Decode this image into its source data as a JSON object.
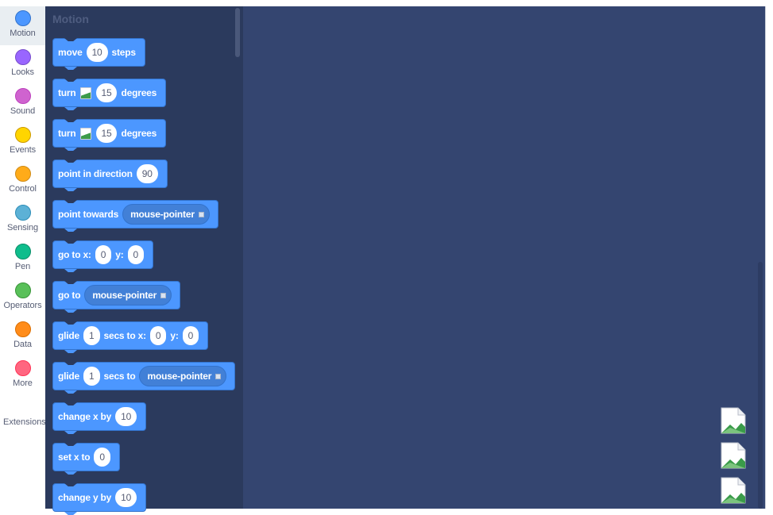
{
  "top_fragment": "1006",
  "categories": [
    {
      "label": "Motion",
      "color": "#4c97ff",
      "border": "#3373cc",
      "selected": true
    },
    {
      "label": "Looks",
      "color": "#9966ff",
      "border": "#774dcb",
      "selected": false
    },
    {
      "label": "Sound",
      "color": "#cf63cf",
      "border": "#bd42bd",
      "selected": false
    },
    {
      "label": "Events",
      "color": "#ffd500",
      "border": "#cc9900",
      "selected": false
    },
    {
      "label": "Control",
      "color": "#ffab19",
      "border": "#cf8b17",
      "selected": false
    },
    {
      "label": "Sensing",
      "color": "#5cb1d6",
      "border": "#2e8eb8",
      "selected": false
    },
    {
      "label": "Pen",
      "color": "#0fbd8c",
      "border": "#0b8e69",
      "selected": false
    },
    {
      "label": "Operators",
      "color": "#59c059",
      "border": "#389438",
      "selected": false
    },
    {
      "label": "Data",
      "color": "#ff8c1a",
      "border": "#db6e00",
      "selected": false
    },
    {
      "label": "More",
      "color": "#ff6680",
      "border": "#ff3355",
      "selected": false
    }
  ],
  "extensions_label": "Extensions",
  "flyout": {
    "section_title": "Motion",
    "blocks": {
      "move": {
        "text1": "move",
        "value": "10",
        "text2": "steps"
      },
      "turn_right": {
        "text1": "turn",
        "icon": "rotate-right-icon",
        "value": "15",
        "text2": "degrees"
      },
      "turn_left": {
        "text1": "turn",
        "icon": "rotate-left-icon",
        "value": "15",
        "text2": "degrees"
      },
      "point_direction": {
        "text1": "point in direction",
        "value": "90"
      },
      "point_towards": {
        "text1": "point towards",
        "menu": "mouse-pointer"
      },
      "go_to_xy": {
        "text1": "go to x:",
        "x": "0",
        "text2": "y:",
        "y": "0"
      },
      "go_to": {
        "text1": "go to",
        "menu": "mouse-pointer"
      },
      "glide_xy": {
        "text1": "glide",
        "secs": "1",
        "text2": "secs to x:",
        "x": "0",
        "text3": "y:",
        "y": "0"
      },
      "glide_to": {
        "text1": "glide",
        "secs": "1",
        "text2": "secs to",
        "menu": "mouse-pointer"
      },
      "change_x": {
        "text1": "change x by",
        "value": "10"
      },
      "set_x": {
        "text1": "set x to",
        "value": "0"
      },
      "change_y": {
        "text1": "change y by",
        "value": "10"
      }
    }
  },
  "workspace": {
    "zoom_buttons": [
      "zoom-in-icon",
      "zoom-out-icon",
      "zoom-reset-icon"
    ],
    "background": "#344570"
  }
}
